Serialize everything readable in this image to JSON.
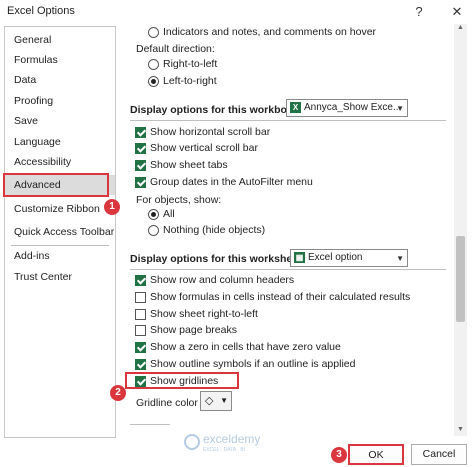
{
  "window": {
    "title": "Excel Options",
    "help_glyph": "?",
    "close_glyph": "✕"
  },
  "sidebar": {
    "items": [
      {
        "label": "General"
      },
      {
        "label": "Formulas"
      },
      {
        "label": "Data"
      },
      {
        "label": "Proofing"
      },
      {
        "label": "Save"
      },
      {
        "label": "Language"
      },
      {
        "label": "Accessibility"
      },
      {
        "label": "Advanced",
        "selected": true
      },
      {
        "label": "Customize Ribbon"
      },
      {
        "label": "Quick Access Toolbar"
      },
      {
        "label": "Add-ins"
      },
      {
        "label": "Trust Center"
      }
    ]
  },
  "content": {
    "indicators_radio": "Indicators and notes, and comments on hover",
    "default_direction_label": "Default direction:",
    "direction_rtl": "Right-to-left",
    "direction_ltr": "Left-to-right",
    "workbook_section": {
      "title": "Display options for this workbook:",
      "combo_value": "Annyca_Show Exce...",
      "options": [
        {
          "label": "Show horizontal scroll bar",
          "checked": true
        },
        {
          "label": "Show vertical scroll bar",
          "checked": true
        },
        {
          "label": "Show sheet tabs",
          "checked": true
        },
        {
          "label": "Group dates in the AutoFilter menu",
          "checked": true
        }
      ],
      "objects_label": "For objects, show:",
      "objects_all": "All",
      "objects_nothing": "Nothing (hide objects)"
    },
    "worksheet_section": {
      "title": "Display options for this worksheet:",
      "combo_value": "Excel option",
      "options": [
        {
          "label": "Show row and column headers",
          "checked": true
        },
        {
          "label": "Show formulas in cells instead of their calculated results",
          "checked": false
        },
        {
          "label": "Show sheet right-to-left",
          "checked": false
        },
        {
          "label": "Show page breaks",
          "checked": false
        },
        {
          "label": "Show a zero in cells that have zero value",
          "checked": true
        },
        {
          "label": "Show outline symbols if an outline is applied",
          "checked": true
        },
        {
          "label": "Show gridlines",
          "checked": true
        }
      ],
      "gridline_color_label": "Gridline color"
    }
  },
  "buttons": {
    "ok": "OK",
    "cancel": "Cancel"
  },
  "annotations": {
    "step1": "1",
    "step2": "2",
    "step3": "3"
  },
  "watermark": {
    "name": "exceldemy",
    "tagline": "EXCEL · DATA · BI"
  },
  "colors": {
    "accent_green": "#217346",
    "highlight_red": "#d9363e"
  }
}
